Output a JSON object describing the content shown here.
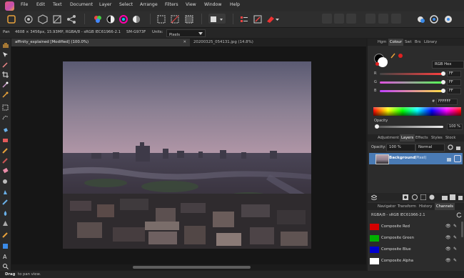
{
  "menu": [
    "File",
    "Edit",
    "Text",
    "Document",
    "Layer",
    "Select",
    "Arrange",
    "Filters",
    "View",
    "Window",
    "Help"
  ],
  "context_bar": {
    "tool": "Pan",
    "info": "4608 × 3456px, 15.93MP, RGBA/8 - sRGB IEC61966-2.1",
    "camera": "SM-G973F",
    "units_label": "Units:",
    "units_value": "Pixels"
  },
  "tabs": [
    {
      "label": "affinity_explained [Modified] (100.0%)",
      "active": true
    },
    {
      "label": "20200325_054131.jpg (14.8%)",
      "active": false
    }
  ],
  "color_panel": {
    "tabs": [
      "Hgm",
      "Colour",
      "Swt",
      "Brs",
      "Library"
    ],
    "active_tab": "Colour",
    "model": "RGB Hex",
    "channels": [
      {
        "label": "R",
        "value": "FF",
        "color": "#ff3030"
      },
      {
        "label": "G",
        "value": "FF",
        "color": "#3cff3c"
      },
      {
        "label": "B",
        "value": "FF",
        "color": "#ffe030"
      }
    ],
    "hex_symbol": "#",
    "hex_value": "FFFFFF",
    "opacity_label": "Opacity",
    "opacity_value": "100 %"
  },
  "layers_panel": {
    "tabs": [
      "Adjustment",
      "Layers",
      "Effects",
      "Styles",
      "Stock"
    ],
    "active_tab": "Layers",
    "opacity_label": "Opacity:",
    "opacity_value": "100 %",
    "blend_mode": "Normal",
    "layer_name": "Background",
    "layer_type": "(Pixel)"
  },
  "channels_panel": {
    "tabs": [
      "Navigator",
      "Transform",
      "History",
      "Channels"
    ],
    "active_tab": "Channels",
    "profile": "RGBA/8 - sRGB IEC61966-2.1",
    "rows": [
      {
        "label": "Composite Red",
        "color": "#d40000"
      },
      {
        "label": "Composite Green",
        "color": "#00b000"
      },
      {
        "label": "Composite Blue",
        "color": "#0000d0"
      },
      {
        "label": "Composite Alpha",
        "color": "#ffffff"
      }
    ]
  },
  "status": {
    "bold": "Drag",
    "text": "to pan view."
  }
}
